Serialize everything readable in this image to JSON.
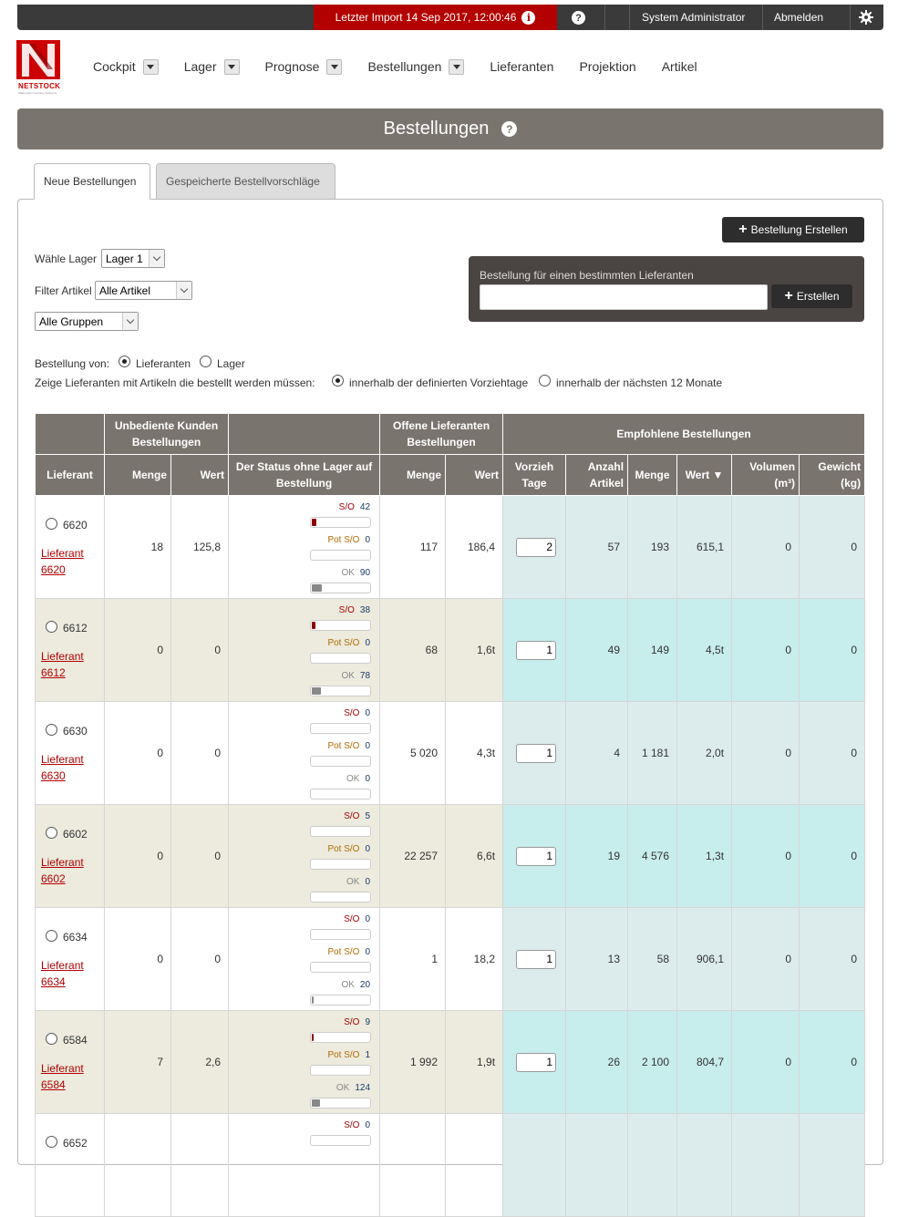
{
  "topbar": {
    "import_text": "Letzter Import 14 Sep 2017, 12:00:46",
    "help_symbol": "?",
    "info_symbol": "i",
    "user": "System Administrator",
    "logout": "Abmelden",
    "gear_icon": "gear-icon"
  },
  "logo": {
    "brand": "NETSTOCK",
    "tagline": "Make better inventory decisions"
  },
  "nav": {
    "items": [
      {
        "label": "Cockpit",
        "dropdown": true
      },
      {
        "label": "Lager",
        "dropdown": true
      },
      {
        "label": "Prognose",
        "dropdown": true
      },
      {
        "label": "Bestellungen",
        "dropdown": true
      },
      {
        "label": "Lieferanten",
        "dropdown": false
      },
      {
        "label": "Projektion",
        "dropdown": false
      },
      {
        "label": "Artikel",
        "dropdown": false
      }
    ]
  },
  "page": {
    "title": "Bestellungen",
    "help_symbol": "?"
  },
  "tabs": {
    "active": "Neue Bestellungen",
    "inactive": "Gespeicherte Bestellvorschläge"
  },
  "controls": {
    "create_order": "Bestellung Erstellen",
    "warehouse_label": "Wähle Lager",
    "warehouse_value": "Lager 1",
    "filter_label": "Filter Artikel",
    "filter_value": "Alle Artikel",
    "groups_value": "Alle Gruppen",
    "supplier_box_caption": "Bestellung für einen bestimmten Lieferanten",
    "supplier_box_button": "Erstellen",
    "order_from_label": "Bestellung von:",
    "order_from_options": [
      "Lieferanten",
      "Lager"
    ],
    "order_from_selected": "Lieferanten",
    "show_suppliers_label": "Zeige Lieferanten mit Artikeln die bestellt werden müssen:",
    "show_options": [
      "innerhalb der definierten Vorziehtage",
      "innerhalb der nächsten 12 Monate"
    ],
    "show_selected": "innerhalb der definierten Vorziehtage"
  },
  "table": {
    "group_headers": {
      "unserved": "Unbediente Kunden Bestellungen",
      "open": "Offene Lieferanten Bestellungen",
      "recommended": "Empfohlene Bestellungen"
    },
    "columns": {
      "supplier": "Lieferant",
      "qty": "Menge",
      "value": "Wert",
      "status": "Der Status ohne Lager auf Bestellung",
      "open_qty": "Menge",
      "open_value": "Wert",
      "lead_days": "Vorzieh Tage",
      "item_count": "Anzahl Artikel",
      "rec_qty": "Menge",
      "rec_value": "Wert ▼",
      "volume": "Volumen (m³)",
      "weight": "Gewicht (kg)"
    },
    "status_keys": {
      "so": "S/O",
      "pot": "Pot S/O",
      "ok": "OK"
    },
    "rows": [
      {
        "id": "6620",
        "link": "Lieferant 6620",
        "qty": "18",
        "value": "125,8",
        "so": "42",
        "pot": "0",
        "ok": "90",
        "so_fill": 0.08,
        "pot_fill": 0,
        "ok_fill": 0.18,
        "open_qty": "117",
        "open_value": "186,4",
        "lead": "2",
        "items": "57",
        "rec_qty": "193",
        "rec_value": "615,1",
        "vol": "0",
        "weight": "0"
      },
      {
        "id": "6612",
        "link": "Lieferant 6612",
        "qty": "0",
        "value": "0",
        "so": "38",
        "pot": "0",
        "ok": "78",
        "so_fill": 0.07,
        "pot_fill": 0,
        "ok_fill": 0.16,
        "open_qty": "68",
        "open_value": "1,6t",
        "lead": "1",
        "items": "49",
        "rec_qty": "149",
        "rec_value": "4,5t",
        "vol": "0",
        "weight": "0"
      },
      {
        "id": "6630",
        "link": "Lieferant 6630",
        "qty": "0",
        "value": "0",
        "so": "0",
        "pot": "0",
        "ok": "0",
        "so_fill": 0,
        "pot_fill": 0,
        "ok_fill": 0,
        "open_qty": "5 020",
        "open_value": "4,3t",
        "lead": "1",
        "items": "4",
        "rec_qty": "1 181",
        "rec_value": "2,0t",
        "vol": "0",
        "weight": "0"
      },
      {
        "id": "6602",
        "link": "Lieferant 6602",
        "qty": "0",
        "value": "0",
        "so": "5",
        "pot": "0",
        "ok": "0",
        "so_fill": 0,
        "pot_fill": 0,
        "ok_fill": 0,
        "open_qty": "22 257",
        "open_value": "6,6t",
        "lead": "1",
        "items": "19",
        "rec_qty": "4 576",
        "rec_value": "1,3t",
        "vol": "0",
        "weight": "0"
      },
      {
        "id": "6634",
        "link": "Lieferant 6634",
        "qty": "0",
        "value": "0",
        "so": "0",
        "pot": "0",
        "ok": "20",
        "so_fill": 0,
        "pot_fill": 0,
        "ok_fill": 0.03,
        "open_qty": "1",
        "open_value": "18,2",
        "lead": "1",
        "items": "13",
        "rec_qty": "58",
        "rec_value": "906,1",
        "vol": "0",
        "weight": "0"
      },
      {
        "id": "6584",
        "link": "Lieferant 6584",
        "qty": "7",
        "value": "2,6",
        "so": "9",
        "pot": "1",
        "ok": "124",
        "so_fill": 0.03,
        "pot_fill": 0,
        "ok_fill": 0.14,
        "open_qty": "1 992",
        "open_value": "1,9t",
        "lead": "1",
        "items": "26",
        "rec_qty": "2 100",
        "rec_value": "804,7",
        "vol": "0",
        "weight": "0"
      },
      {
        "id": "6652",
        "link": "",
        "qty": "",
        "value": "",
        "so": "0",
        "pot": "",
        "ok": "",
        "so_fill": 0,
        "pot_fill": 0,
        "ok_fill": 0,
        "open_qty": "",
        "open_value": "",
        "lead": "",
        "items": "",
        "rec_qty": "",
        "rec_value": "",
        "vol": "",
        "weight": ""
      }
    ]
  },
  "colors": {
    "brand_red": "#c00000",
    "header_gray": "#7a746f",
    "row_alt": "#ecebde",
    "rec_teal": "#c8eded"
  }
}
